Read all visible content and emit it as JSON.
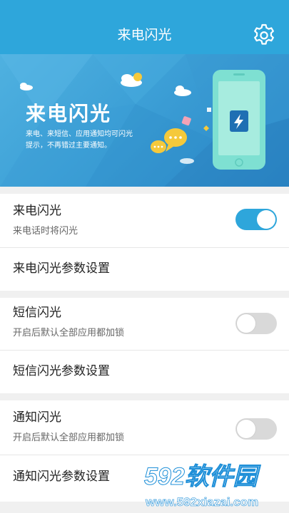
{
  "header": {
    "title": "来电闪光",
    "settings_icon": "gear-icon"
  },
  "banner": {
    "headline": "来电闪光",
    "desc_line1": "来电、来短信、应用通知均可闪光",
    "desc_line2": "提示，不再错过主要通知。"
  },
  "call": {
    "title": "来电闪光",
    "subtitle": "来电话时将闪光",
    "toggle": "on",
    "settings_label": "来电闪光参数设置"
  },
  "sms": {
    "title": "短信闪光",
    "subtitle": "开启后默认全部应用都加锁",
    "toggle": "off",
    "settings_label": "短信闪光参数设置"
  },
  "notify": {
    "title": "通知闪光",
    "subtitle": "开启后默认全部应用都加锁",
    "toggle": "off",
    "settings_label": "通知闪光参数设置"
  },
  "watermark": {
    "brand": "592软件园",
    "url": "www.592xiazai.com"
  },
  "colors": {
    "accent": "#2ea6db",
    "toggle_off": "#d9d9d9",
    "watermark_blue": "#1e8fd8"
  }
}
